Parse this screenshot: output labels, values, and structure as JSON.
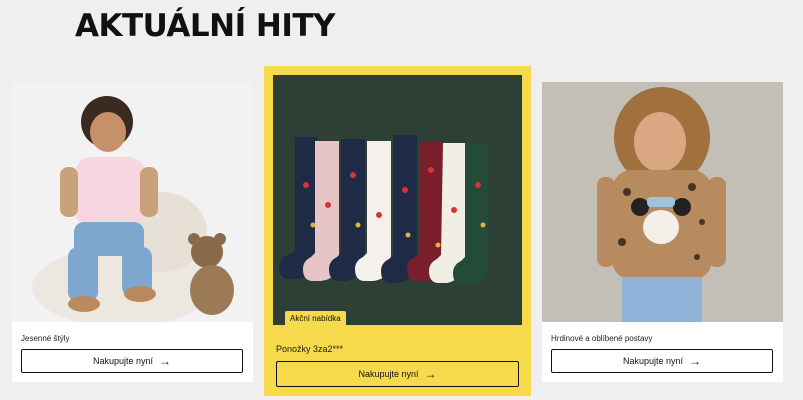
{
  "section": {
    "title": "AKTUÁLNÍ HITY"
  },
  "cards": [
    {
      "caption": "Jesenné štýly",
      "cta_label": "Nakupujte nyní",
      "image_alt": "Child in pink vest with teddy bear"
    },
    {
      "caption": "Ponožky 3za2***",
      "cta_label": "Nakupujte nyní",
      "badge": "Akční nabídka",
      "image_alt": "Christmas socks"
    },
    {
      "caption": "Hrdinové a oblíbené postavy",
      "cta_label": "Nakupujte nyní",
      "image_alt": "Girl in Minnie sweater"
    }
  ],
  "colors": {
    "accent": "#f7d94c",
    "feature_bg": "#2e4036"
  }
}
